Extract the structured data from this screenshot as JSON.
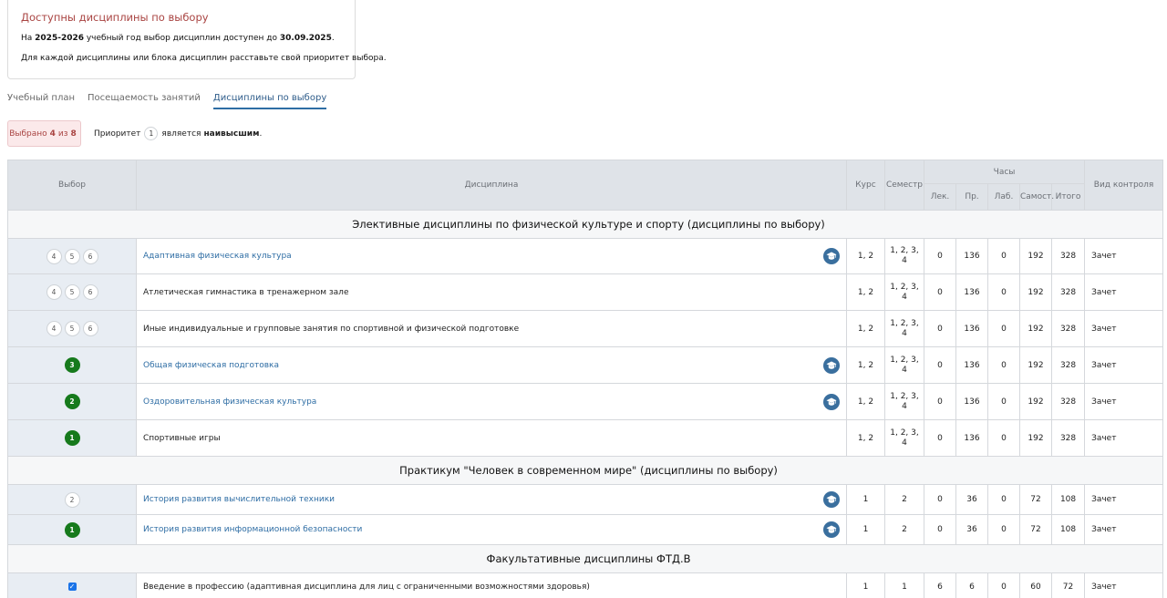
{
  "notice": {
    "title": "Доступны дисциплины по выбору",
    "line1_prefix": "На ",
    "line1_years": "2025-2026",
    "line1_middle": " учебный год выбор дисциплин доступен до ",
    "line1_date": "30.09.2025",
    "line1_suffix": ".",
    "line2": "Для каждой дисциплины или блока дисциплин расставьте свой приоритет выбора."
  },
  "tabs": [
    {
      "label": "Учебный план",
      "active": false
    },
    {
      "label": "Посещаемость занятий",
      "active": false
    },
    {
      "label": "Дисциплины по выбору",
      "active": true
    }
  ],
  "selection": {
    "prefix": "Выбрано",
    "count": "4",
    "of": "из",
    "total": "8"
  },
  "priority_note": {
    "prefix": "Приоритет",
    "value": "1",
    "middle": "является",
    "bold": "наивысшим",
    "suffix": "."
  },
  "table": {
    "headers": {
      "choice": "Выбор",
      "discipline": "Дисциплина",
      "course": "Курс",
      "semester": "Семестр",
      "hours": "Часы",
      "lec": "Лек.",
      "pr": "Пр.",
      "lab": "Лаб.",
      "self": "Самост.",
      "total": "Итого",
      "control": "Вид контроля"
    },
    "groups": [
      {
        "title": "Элективные дисциплины по физической культуре и спорту (дисциплины по выбору)",
        "rows": [
          {
            "choice": [
              "4",
              "5",
              "6"
            ],
            "name": "Адаптивная физическая культура",
            "link": true,
            "icon": true,
            "course": "1, 2",
            "semester": [
              "1, 2, 3,",
              "4"
            ],
            "lec": "0",
            "pr": "136",
            "lab": "0",
            "self": "192",
            "total": "328",
            "control": "Зачет"
          },
          {
            "choice": [
              "4",
              "5",
              "6"
            ],
            "name": "Атлетическая гимнастика в тренажерном зале",
            "link": false,
            "icon": false,
            "course": "1, 2",
            "semester": [
              "1, 2, 3,",
              "4"
            ],
            "lec": "0",
            "pr": "136",
            "lab": "0",
            "self": "192",
            "total": "328",
            "control": "Зачет"
          },
          {
            "choice": [
              "4",
              "5",
              "6"
            ],
            "name": "Иные индивидуальные и групповые занятия по спортивной и физической подготовке",
            "link": false,
            "icon": false,
            "course": "1, 2",
            "semester": [
              "1, 2, 3,",
              "4"
            ],
            "lec": "0",
            "pr": "136",
            "lab": "0",
            "self": "192",
            "total": "328",
            "control": "Зачет"
          },
          {
            "choice_selected": "3",
            "name": "Общая физическая подготовка",
            "link": true,
            "icon": true,
            "course": "1, 2",
            "semester": [
              "1, 2, 3,",
              "4"
            ],
            "lec": "0",
            "pr": "136",
            "lab": "0",
            "self": "192",
            "total": "328",
            "control": "Зачет"
          },
          {
            "choice_selected": "2",
            "name": "Оздоровительная физическая культура",
            "link": true,
            "icon": true,
            "course": "1, 2",
            "semester": [
              "1, 2, 3,",
              "4"
            ],
            "lec": "0",
            "pr": "136",
            "lab": "0",
            "self": "192",
            "total": "328",
            "control": "Зачет"
          },
          {
            "choice_selected": "1",
            "name": "Спортивные игры",
            "link": false,
            "icon": false,
            "course": "1, 2",
            "semester": [
              "1, 2, 3,",
              "4"
            ],
            "lec": "0",
            "pr": "136",
            "lab": "0",
            "self": "192",
            "total": "328",
            "control": "Зачет"
          }
        ]
      },
      {
        "title": "Практикум \"Человек в современном мире\" (дисциплины по выбору)",
        "rows": [
          {
            "choice": [
              "2"
            ],
            "name": "История развития вычислительной техники",
            "link": true,
            "icon": true,
            "course": "1",
            "semester": [
              "2"
            ],
            "lec": "0",
            "pr": "36",
            "lab": "0",
            "self": "72",
            "total": "108",
            "control": "Зачет"
          },
          {
            "choice_selected": "1",
            "name": "История развития информационной безопасности",
            "link": true,
            "icon": true,
            "course": "1",
            "semester": [
              "2"
            ],
            "lec": "0",
            "pr": "36",
            "lab": "0",
            "self": "72",
            "total": "108",
            "control": "Зачет"
          }
        ]
      },
      {
        "title": "Факультативные дисциплины ФТД.В",
        "rows": [
          {
            "checkbox": true,
            "checkbox_glyph": "✓",
            "name": "Введение в профессию (адаптивная дисциплина для лиц с ограниченными возможностями здоровья)",
            "link": false,
            "icon": false,
            "course": "1",
            "semester": [
              "1"
            ],
            "lec": "6",
            "pr": "6",
            "lab": "0",
            "self": "60",
            "total": "72",
            "control": "Зачет"
          }
        ]
      }
    ]
  },
  "icons": {
    "education": "graduation-cap-icon"
  },
  "colors": {
    "accent": "#2e6da4",
    "danger": "#a94442",
    "selected": "#167a1c",
    "header_bg": "#dfe3e8",
    "choice_bg": "#e8edf3"
  }
}
